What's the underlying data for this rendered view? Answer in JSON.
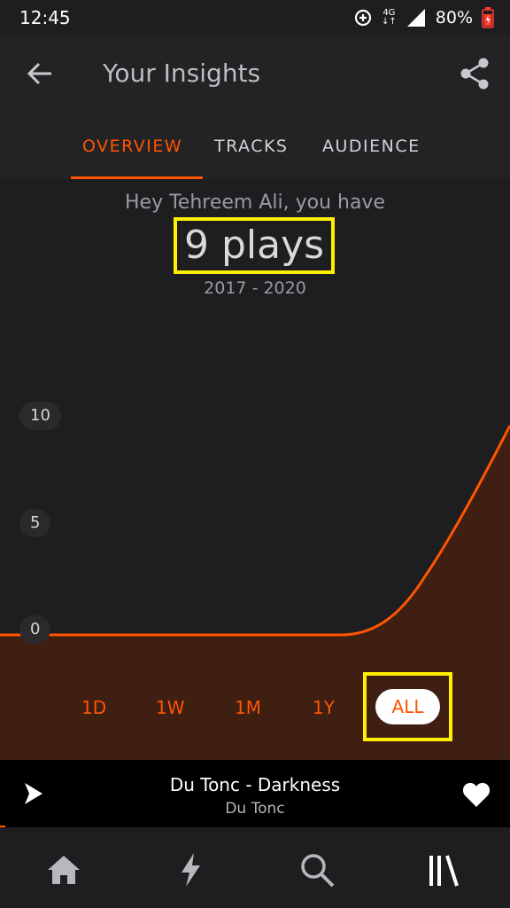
{
  "status_bar": {
    "time": "12:45",
    "network": "4G",
    "battery": "80%",
    "icons": [
      "data-saver-icon",
      "signal-icon",
      "battery-icon"
    ]
  },
  "header": {
    "title": "Your Insights",
    "back_icon": "arrow-left-icon",
    "share_icon": "share-icon"
  },
  "tabs": [
    {
      "label": "OVERVIEW",
      "active": true
    },
    {
      "label": "TRACKS",
      "active": false
    },
    {
      "label": "AUDIENCE",
      "active": false
    }
  ],
  "summary": {
    "greeting": "Hey Tehreem Ali, you have",
    "plays": "9 plays",
    "range": "2017 - 2020"
  },
  "chart_data": {
    "type": "area",
    "y_ticks": [
      "10",
      "5",
      "0"
    ],
    "ylim": [
      0,
      10
    ],
    "series_color": "#ff5500",
    "description_points": [
      {
        "x": 0,
        "y": 0
      },
      {
        "x": 0.67,
        "y": 0
      },
      {
        "x": 0.78,
        "y": 1.5
      },
      {
        "x": 0.9,
        "y": 5
      },
      {
        "x": 1.0,
        "y": 9.5
      }
    ]
  },
  "periods": [
    {
      "label": "1D",
      "selected": false
    },
    {
      "label": "1W",
      "selected": false
    },
    {
      "label": "1M",
      "selected": false
    },
    {
      "label": "1Y",
      "selected": false
    },
    {
      "label": "ALL",
      "selected": true
    }
  ],
  "player": {
    "title": "Du Tonc - Darkness",
    "artist": "Du Tonc"
  },
  "bottom_nav": [
    "home-icon",
    "stream-icon",
    "search-icon",
    "library-icon"
  ],
  "colors": {
    "accent": "#ff5500",
    "highlight": "#ffef00",
    "background": "#1e1d20"
  }
}
